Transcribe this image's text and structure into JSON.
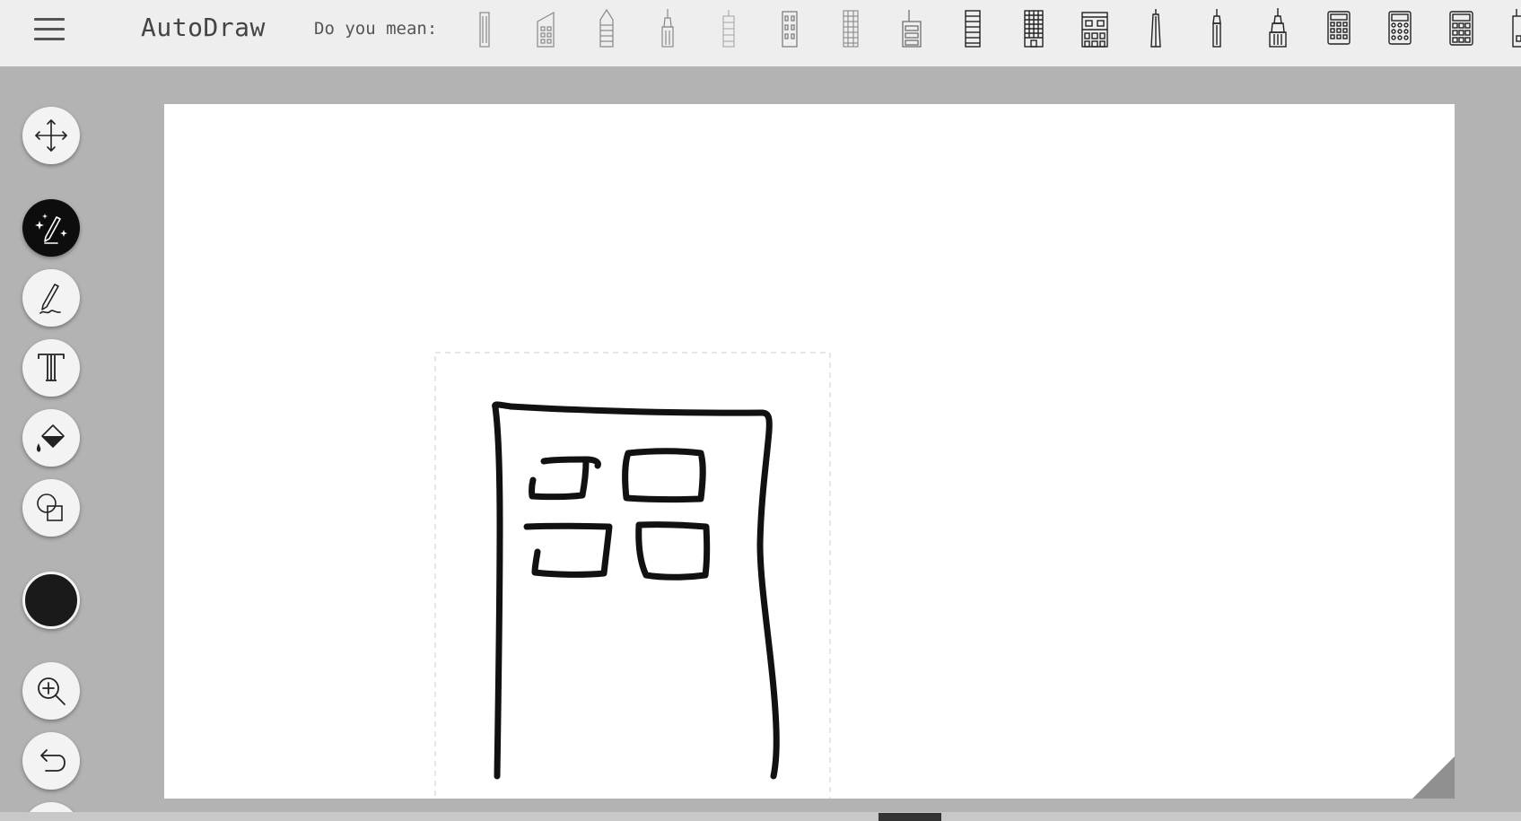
{
  "app": {
    "title": "AutoDraw"
  },
  "suggestions": {
    "label": "Do you mean:",
    "items": [
      {
        "icon": "tall-skyscraper-icon"
      },
      {
        "icon": "angled-office-building-icon"
      },
      {
        "icon": "glass-tower-icon"
      },
      {
        "icon": "spire-skyscraper-icon"
      },
      {
        "icon": "thin-tower-icon"
      },
      {
        "icon": "window-block-building-icon"
      },
      {
        "icon": "gridded-tower-icon"
      },
      {
        "icon": "antenna-building-icon"
      },
      {
        "icon": "striped-tower-icon"
      },
      {
        "icon": "dense-window-building-icon"
      },
      {
        "icon": "shop-building-icon"
      },
      {
        "icon": "obelisk-tower-icon"
      },
      {
        "icon": "needle-tower-icon"
      },
      {
        "icon": "empire-state-building-icon"
      },
      {
        "icon": "calculator-icon"
      },
      {
        "icon": "round-button-calculator-icon"
      },
      {
        "icon": "desk-calculator-icon"
      },
      {
        "icon": "partial-building-icon"
      }
    ]
  },
  "toolbar": {
    "tools": [
      {
        "name": "move-tool",
        "icon": "move-arrows-icon",
        "active": false
      },
      {
        "name": "autodraw-tool",
        "icon": "autodraw-sparkle-pencil-icon",
        "active": true
      },
      {
        "name": "draw-tool",
        "icon": "pencil-icon",
        "active": false
      },
      {
        "name": "type-tool",
        "icon": "text-icon",
        "active": false
      },
      {
        "name": "fill-tool",
        "icon": "paint-bucket-icon",
        "active": false
      },
      {
        "name": "shape-tool",
        "icon": "shapes-icon",
        "active": false
      },
      {
        "name": "zoom-tool",
        "icon": "zoom-in-icon",
        "active": false
      },
      {
        "name": "undo-tool",
        "icon": "undo-icon",
        "active": false
      }
    ],
    "current_color": "#1a1a1a"
  },
  "colors": {
    "topbar": "#eeeeee",
    "workspace": "#b3b3b3",
    "canvas": "#ffffff",
    "active_tool": "#0d0d0d",
    "ink": "#111111"
  }
}
